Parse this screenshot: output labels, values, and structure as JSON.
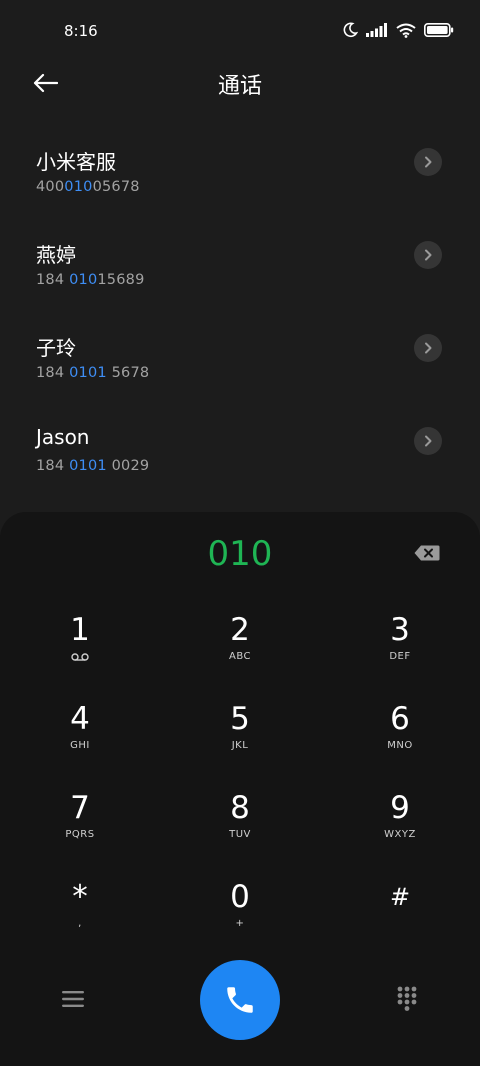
{
  "status_bar": {
    "time": "8:16",
    "icons": [
      "moon-icon",
      "signal-icon",
      "wifi-icon",
      "battery-icon"
    ]
  },
  "header": {
    "title": "通话",
    "back_icon": "back-arrow-icon"
  },
  "contacts": [
    {
      "name": "小米客服",
      "number_pre": "400",
      "number_match": "010",
      "number_post": "05678"
    },
    {
      "name": "燕婷",
      "number_pre": "184 ",
      "number_match": "010",
      "number_post": "15689"
    },
    {
      "name": "子玲",
      "number_pre": "184 ",
      "number_match": "0101",
      "number_post": " 5678"
    },
    {
      "name": "Jason",
      "number_pre": "184 ",
      "number_match": "0101",
      "number_post": " 0029"
    }
  ],
  "dialpad": {
    "input_value": "010",
    "keys": [
      {
        "digit": "1",
        "letters": ""
      },
      {
        "digit": "2",
        "letters": "ABC"
      },
      {
        "digit": "3",
        "letters": "DEF"
      },
      {
        "digit": "4",
        "letters": "GHI"
      },
      {
        "digit": "5",
        "letters": "JKL"
      },
      {
        "digit": "6",
        "letters": "MNO"
      },
      {
        "digit": "7",
        "letters": "PQRS"
      },
      {
        "digit": "8",
        "letters": "TUV"
      },
      {
        "digit": "9",
        "letters": "WXYZ"
      },
      {
        "digit": "*",
        "letters": ","
      },
      {
        "digit": "0",
        "letters": "+"
      },
      {
        "digit": "#",
        "letters": ""
      }
    ]
  },
  "colors": {
    "background": "#1c1c1c",
    "panel": "#141414",
    "match_highlight": "#3e8ef5",
    "dial_input": "#1fb554",
    "call_button": "#1e86f3"
  }
}
